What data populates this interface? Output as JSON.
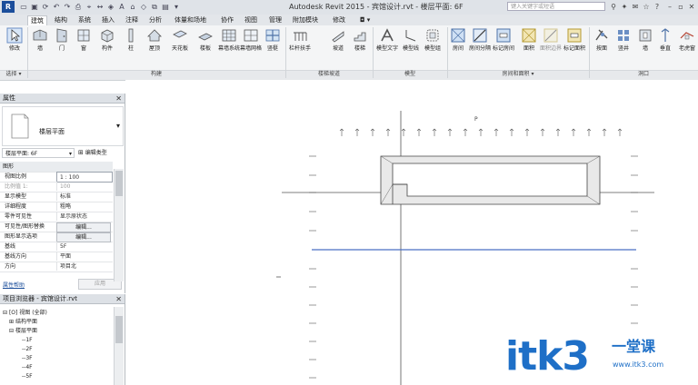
{
  "app": {
    "title": "Autodesk Revit 2015 -  宾馆设计.rvt - 楼层平面: 6F",
    "search_placeholder": "键入关键字或短语",
    "logo": "R",
    "colors": {
      "accent": "#1b4e9b",
      "selection_line": "#4a6fc4",
      "watermark": "#1e6fc7"
    }
  },
  "tabs": [
    {
      "label": "建筑",
      "active": true
    },
    {
      "label": "结构"
    },
    {
      "label": "系统"
    },
    {
      "label": "插入"
    },
    {
      "label": "注释"
    },
    {
      "label": "分析"
    },
    {
      "label": "体量和场地"
    },
    {
      "label": "协作"
    },
    {
      "label": "视图"
    },
    {
      "label": "管理"
    },
    {
      "label": "附加模块"
    },
    {
      "label": "修改"
    }
  ],
  "ribbon": {
    "buttons": [
      "修改",
      "墙",
      "门",
      "窗",
      "构件",
      "柱",
      "屋顶",
      "天花板",
      "楼板",
      "幕墙系统",
      "幕墙网格",
      "竖梃",
      "栏杆扶手",
      "坡道",
      "楼梯",
      "模型文字",
      "模型线",
      "模型组",
      "房间",
      "房间分隔",
      "标记房间",
      "面积",
      "面积边界",
      "标记面积",
      "按面",
      "竖井",
      "墙",
      "垂直",
      "老虎窗"
    ],
    "groups": [
      "选择 ▾",
      "构建",
      "楼梯坡道",
      "模型",
      "房间和面积 ▾",
      "洞口"
    ]
  },
  "properties": {
    "title": "属性",
    "type_name": "楼层平面",
    "selector": "楼层平面: 6F",
    "edit_type": "编辑类型",
    "category": "图形",
    "rows": [
      {
        "k": "视图比例",
        "v": "1 : 100"
      },
      {
        "k": "比例值 1:",
        "v": "100"
      },
      {
        "k": "显示模型",
        "v": "标准"
      },
      {
        "k": "详细程度",
        "v": "粗略"
      },
      {
        "k": "零件可见性",
        "v": "显示原状态"
      },
      {
        "k": "可见性/图形替换",
        "v": "编辑..."
      },
      {
        "k": "图形显示选项",
        "v": "编辑..."
      },
      {
        "k": "基线",
        "v": "5F"
      },
      {
        "k": "基线方向",
        "v": "平面"
      },
      {
        "k": "方向",
        "v": "项目北"
      }
    ],
    "help_link": "属性帮助",
    "apply": "应用"
  },
  "browser": {
    "title": "项目浏览器 - 宾馆设计.rvt",
    "nodes": [
      "视图 (全部)",
      "结构平面",
      "楼层平面",
      "1F",
      "2F",
      "3F",
      "4F",
      "5F"
    ]
  },
  "canvas": {
    "north_mark": "P"
  },
  "watermark": {
    "brand": "itk3",
    "sub": "一堂课",
    "url": "www.itk3.com"
  }
}
